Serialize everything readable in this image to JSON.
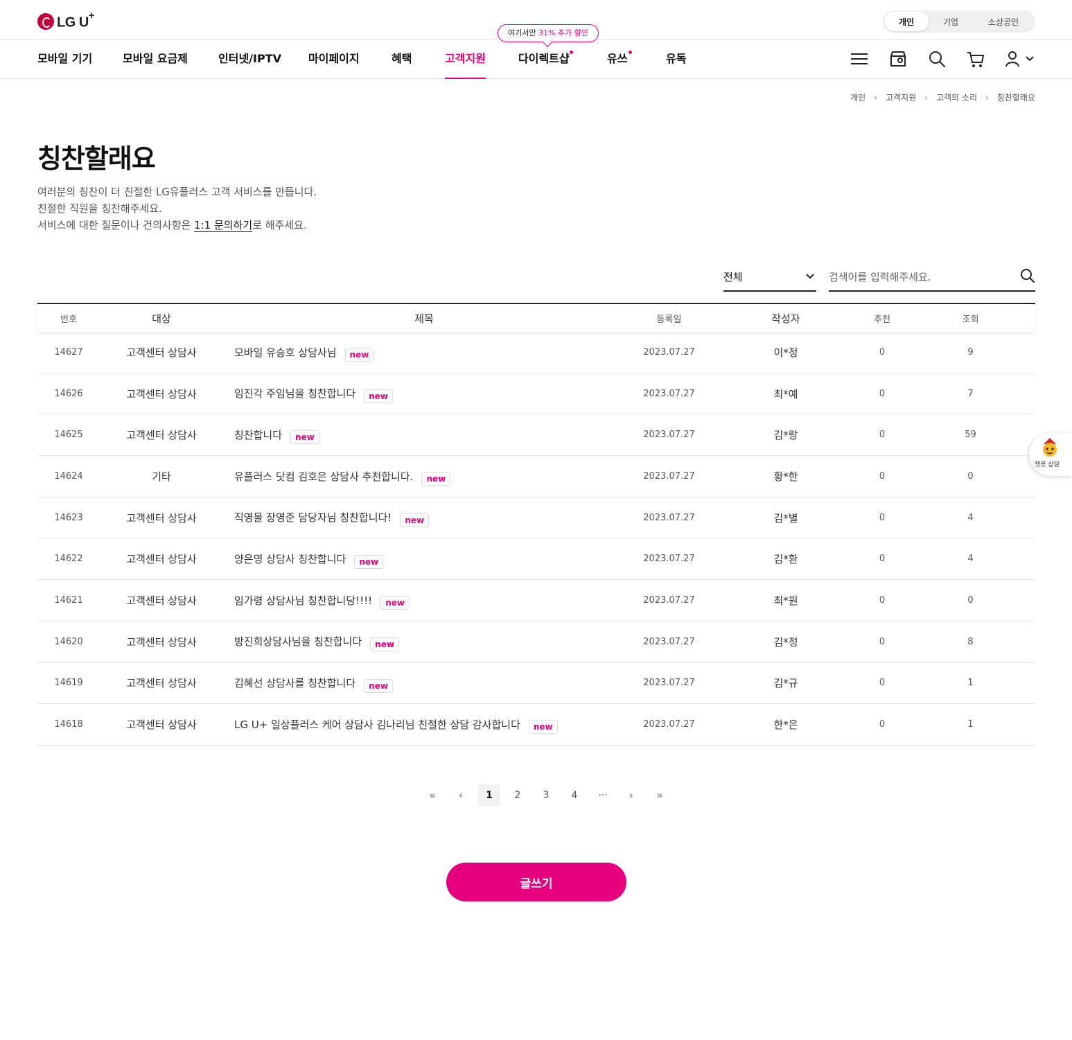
{
  "brand": {
    "name": "LG U",
    "plus": "+"
  },
  "segment": {
    "options": [
      "개인",
      "기업",
      "소상공인"
    ],
    "selected": "개인"
  },
  "nav": {
    "items": [
      "모바일 기기",
      "모바일 요금제",
      "인터넷/IPTV",
      "마이페이지",
      "혜택",
      "고객지원",
      "다이렉트샵",
      "유쓰",
      "유독"
    ],
    "active": "고객지원",
    "promo_prefix": "여기서만 ",
    "promo_highlight": "31% 추가 할인",
    "accent": "#e6007e"
  },
  "icons": {
    "menu": "hamburger-icon",
    "store": "store-location-icon",
    "search": "search-icon",
    "cart": "cart-icon",
    "user": "user-icon"
  },
  "breadcrumb": [
    "개인",
    "고객지원",
    "고객의 소리",
    "칭찬할래요"
  ],
  "page": {
    "title": "칭찬할래요",
    "desc_line1": "여러분의 칭찬이 더 친절한 LG유플러스 고객 서비스를 만듭니다.",
    "desc_line2": "친절한 직원을 칭찬해주세요.",
    "desc_line3_pre": "서비스에 대한 질문이나 건의사항은 ",
    "desc_line3_link": "1:1 문의하기",
    "desc_line3_post": "로 해주세요."
  },
  "filter": {
    "selected": "전체",
    "search_placeholder": "검색어를 입력해주세요."
  },
  "table": {
    "headers": [
      "번호",
      "대상",
      "제목",
      "등록일",
      "작성자",
      "추천",
      "조회"
    ],
    "new_label": "new",
    "rows": [
      {
        "num": "14627",
        "target": "고객센터 상담사",
        "subject": "모바일 유승호 상담사님",
        "date": "2023.07.27",
        "author": "이*정",
        "rec": "0",
        "views": "9"
      },
      {
        "num": "14626",
        "target": "고객센터 상담사",
        "subject": "임진각 주임님을 칭찬합니다",
        "date": "2023.07.27",
        "author": "최*예",
        "rec": "0",
        "views": "7"
      },
      {
        "num": "14625",
        "target": "고객센터 상담사",
        "subject": "칭찬합니다",
        "date": "2023.07.27",
        "author": "김*랑",
        "rec": "0",
        "views": "59"
      },
      {
        "num": "14624",
        "target": "기타",
        "subject": "유플러스 닷컴 김호은 상담사 추천합니다.",
        "date": "2023.07.27",
        "author": "황*한",
        "rec": "0",
        "views": "0"
      },
      {
        "num": "14623",
        "target": "고객센터 상담사",
        "subject": "직영몰 장영준 담당자님 칭찬합니다!",
        "date": "2023.07.27",
        "author": "김*별",
        "rec": "0",
        "views": "4"
      },
      {
        "num": "14622",
        "target": "고객센터 상담사",
        "subject": "양은영 상담사 칭찬합니다",
        "date": "2023.07.27",
        "author": "김*환",
        "rec": "0",
        "views": "4"
      },
      {
        "num": "14621",
        "target": "고객센터 상담사",
        "subject": "임가령 상담사님 칭찬합니당!!!!",
        "date": "2023.07.27",
        "author": "최*원",
        "rec": "0",
        "views": "0"
      },
      {
        "num": "14620",
        "target": "고객센터 상담사",
        "subject": "방진희상담사님을 칭찬합니다",
        "date": "2023.07.27",
        "author": "김*정",
        "rec": "0",
        "views": "8"
      },
      {
        "num": "14619",
        "target": "고객센터 상담사",
        "subject": "김혜선 상담사를 칭찬합니다",
        "date": "2023.07.27",
        "author": "김*규",
        "rec": "0",
        "views": "1"
      },
      {
        "num": "14618",
        "target": "고객센터 상담사",
        "subject": "LG U+ 일상플러스 케어 상담사 김나리님 친절한 상담 감사합니다",
        "date": "2023.07.27",
        "author": "한*은",
        "rec": "0",
        "views": "1"
      }
    ]
  },
  "pagination": {
    "first": "«",
    "prev": "‹",
    "pages": [
      "1",
      "2",
      "3",
      "4"
    ],
    "current": "1",
    "ellipsis": "···",
    "next": "›",
    "last": "»"
  },
  "write_button": "글쓰기",
  "chatbot": {
    "label": "챗봇 상담"
  }
}
